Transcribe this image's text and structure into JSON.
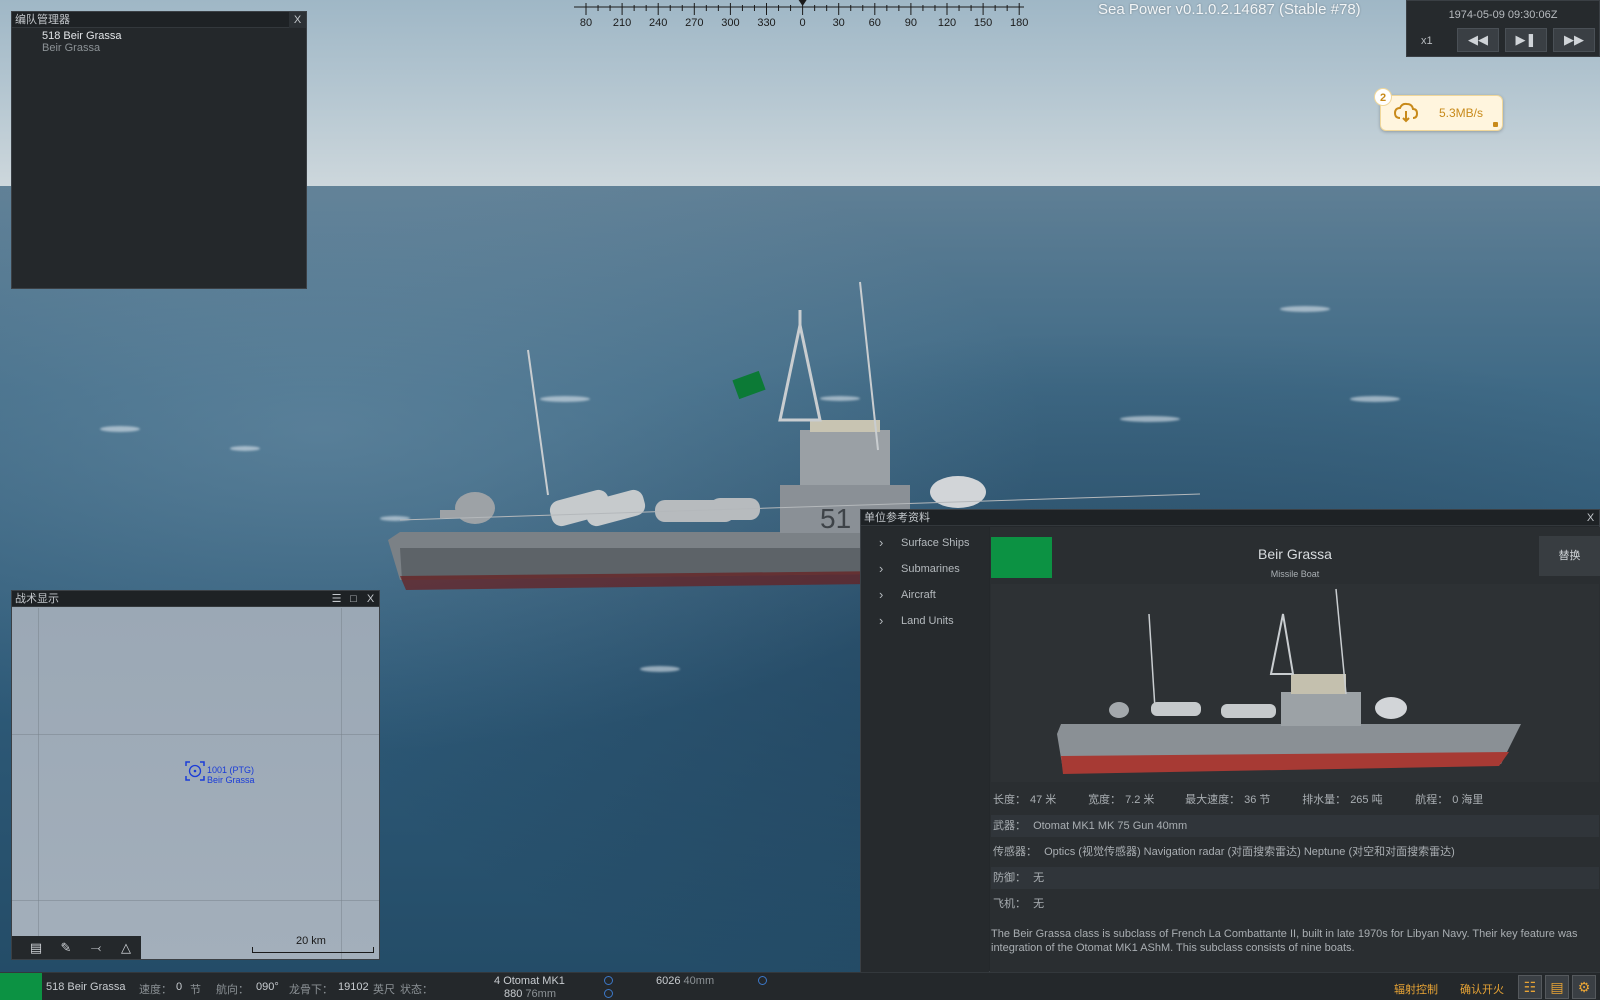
{
  "version": "Sea Power v0.1.0.2.14687 (Stable #78)",
  "compass": {
    "labels": [
      "80",
      "210",
      "240",
      "270",
      "300",
      "330",
      "0",
      "30",
      "60",
      "90",
      "120",
      "150",
      "180"
    ]
  },
  "time_panel": {
    "datetime": "1974-05-09 09:30:06Z",
    "speed": "x1",
    "rewind_icon": "rewind-icon",
    "play_pause_icon": "play-pause-icon",
    "fast_forward_icon": "fast-forward-icon"
  },
  "download": {
    "badge": "2",
    "rate": "5.3MB/s",
    "icon": "cloud-download-icon",
    "accent": "#c88a1a"
  },
  "fleet_manager": {
    "title": "编队管理器",
    "close": "X",
    "unit_name": "518 Beir Grassa",
    "unit_class": "Beir Grassa"
  },
  "tactical": {
    "title": "战术显示",
    "close": "X",
    "unit_label1": "1001 (PTG)",
    "unit_label2": "Beir Grassa",
    "scale": "20 km",
    "tools": [
      "ruler-icon",
      "pencil-icon",
      "compass-icon",
      "eraser-icon"
    ]
  },
  "unit_ref": {
    "title": "单位参考资料",
    "close": "X",
    "categories": [
      "Surface Ships",
      "Submarines",
      "Aircraft",
      "Land Units"
    ],
    "name": "Beir Grassa",
    "type": "Missile Boat",
    "replace_button": "替换",
    "flag_color": "#0c9243",
    "stats": {
      "length_label": "长度：",
      "length_value": "47 米",
      "beam_label": "宽度：",
      "beam_value": "7.2 米",
      "speed_label": "最大速度：",
      "speed_value": "36 节",
      "displacement_label": "排水量：",
      "displacement_value": "265 吨",
      "range_label": "航程：",
      "range_value": "0 海里"
    },
    "weapons_label": "武器：",
    "weapons": "Otomat MK1  MK 75 Gun  40mm",
    "sensors_label": "传感器：",
    "sensors": "Optics (视觉传感器)  Navigation radar (对面搜索雷达)  Neptune (对空和对面搜索雷达)",
    "defense_label": "防御：",
    "defense": "无",
    "aircraft_label": "飞机：",
    "aircraft": "无",
    "description": "The Beir Grassa class is subclass of French La Combattante II, built in late 1970s for Libyan Navy. Their key feature was integration of the Otomat MK1 AShM. This subclass consists of nine boats."
  },
  "status_bar": {
    "unit": "518 Beir Grassa",
    "speed_label": "速度：",
    "speed_value": "0",
    "speed_unit": "节",
    "heading_label": "航向：",
    "heading_value": "090°",
    "keel_label": "龙骨下：",
    "keel_value": "19102",
    "keel_unit": "英尺",
    "state_label": "状态：",
    "ammo1_count": "4",
    "ammo1_name": "Otomat MK1",
    "ammo2_count": "880",
    "ammo2_name": "76mm",
    "ammo3_count": "6026",
    "ammo3_name": "40mm",
    "emcon": "辐射控制",
    "confirm_fire": "确认开火",
    "icons": [
      "formation-icon",
      "document-icon",
      "settings-icon"
    ]
  }
}
